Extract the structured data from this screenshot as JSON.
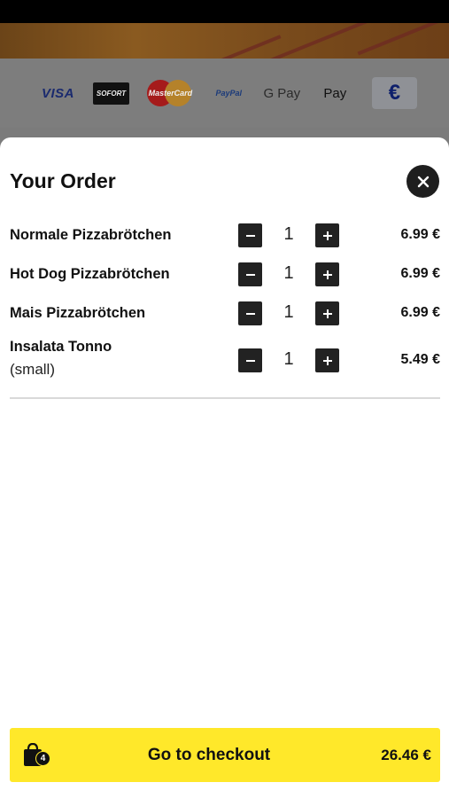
{
  "payment_methods": {
    "visa": "VISA",
    "sofort": "SOFORT",
    "mastercard": "MasterCard",
    "paypal": "PayPal",
    "gpay": "G Pay",
    "applepay": " Pay",
    "euro": "€"
  },
  "order": {
    "title": "Your Order",
    "items": [
      {
        "name": "Normale Pizzabrötchen",
        "variant": "",
        "qty": "1",
        "price": "6.99 €"
      },
      {
        "name": "Hot Dog Pizzabrötchen",
        "variant": "",
        "qty": "1",
        "price": "6.99 €"
      },
      {
        "name": "Mais Pizzabrötchen",
        "variant": "",
        "qty": "1",
        "price": "6.99 €"
      },
      {
        "name": "Insalata Tonno",
        "variant": "(small)",
        "qty": "1",
        "price": "5.49 €"
      }
    ]
  },
  "checkout": {
    "label": "Go to checkout",
    "item_count": "4",
    "total": "26.46 €"
  },
  "colors": {
    "checkout_bg": "#ffe82a",
    "button_dark": "#222222"
  },
  "icons": {
    "close": "close-icon",
    "minus": "minus-icon",
    "plus": "plus-icon",
    "bag": "shopping-bag-icon"
  }
}
